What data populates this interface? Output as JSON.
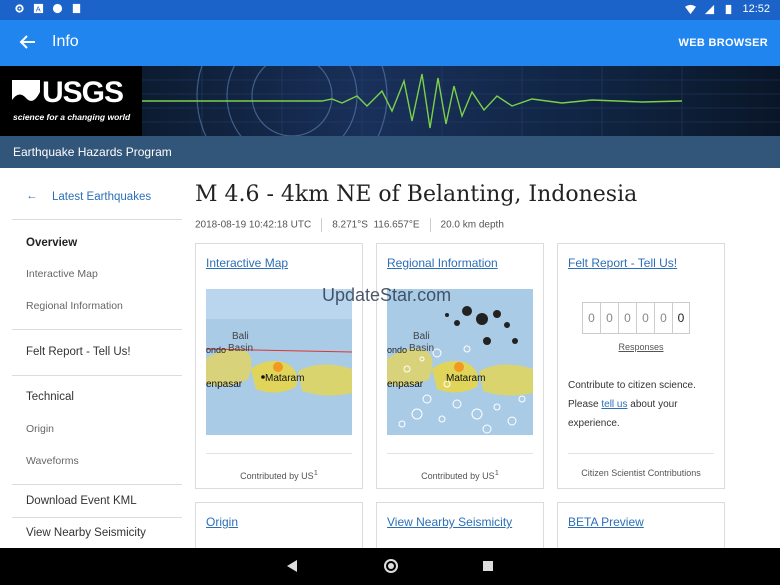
{
  "status_bar": {
    "time": "12:52",
    "left_icons": [
      "gear-icon",
      "a-icon",
      "circle-icon",
      "document-icon"
    ],
    "right_icons": [
      "wifi-icon",
      "signal-icon",
      "battery-icon"
    ]
  },
  "app_bar": {
    "title": "Info",
    "action_label": "WEB BROWSER"
  },
  "banner": {
    "logo_text": "USGS",
    "tagline": "science for a changing world"
  },
  "program_bar": {
    "label": "Earthquake Hazards Program"
  },
  "sidebar": {
    "back_label": "Latest Earthquakes",
    "overview": "Overview",
    "interactive_map": "Interactive Map",
    "regional_information": "Regional Information",
    "felt_report": "Felt Report - Tell Us!",
    "technical": "Technical",
    "origin": "Origin",
    "waveforms": "Waveforms",
    "download_kml": "Download Event KML",
    "nearby_seismicity": "View Nearby Seismicity"
  },
  "event": {
    "title": "M 4.6 - 4km NE of Belanting, Indonesia",
    "datetime": "2018-08-19 10:42:18 UTC",
    "coordinates": "8.271°S  116.657°E",
    "depth": "20.0 km depth"
  },
  "watermark": "UpdateStar.com",
  "cards": {
    "interactive_map": {
      "title": "Interactive Map",
      "contrib": "Contributed by US",
      "contrib_sup": "1",
      "map_labels": [
        "Bali",
        "Basin",
        "ondo",
        "enpasar",
        "Mataram"
      ]
    },
    "regional_information": {
      "title": "Regional Information",
      "contrib": "Contributed by US",
      "contrib_sup": "1",
      "map_labels": [
        "Bali",
        "Basin",
        "ondo",
        "enpasar",
        "Mataram"
      ]
    },
    "felt_report": {
      "title": "Felt Report - Tell Us!",
      "digits": [
        "0",
        "0",
        "0",
        "0",
        "0",
        "0"
      ],
      "responses": "Responses",
      "text_before": "Contribute to citizen science. Please ",
      "text_link": "tell us",
      "text_after": " about your experience.",
      "footer": "Citizen Scientist Contributions"
    },
    "origin": {
      "title": "Origin"
    },
    "nearby_seismicity": {
      "title": "View Nearby Seismicity"
    },
    "beta_preview": {
      "title": "BETA Preview"
    }
  },
  "nav_bar": {
    "icons": [
      "back-triangle-icon",
      "home-circle-icon",
      "recents-square-icon"
    ]
  }
}
